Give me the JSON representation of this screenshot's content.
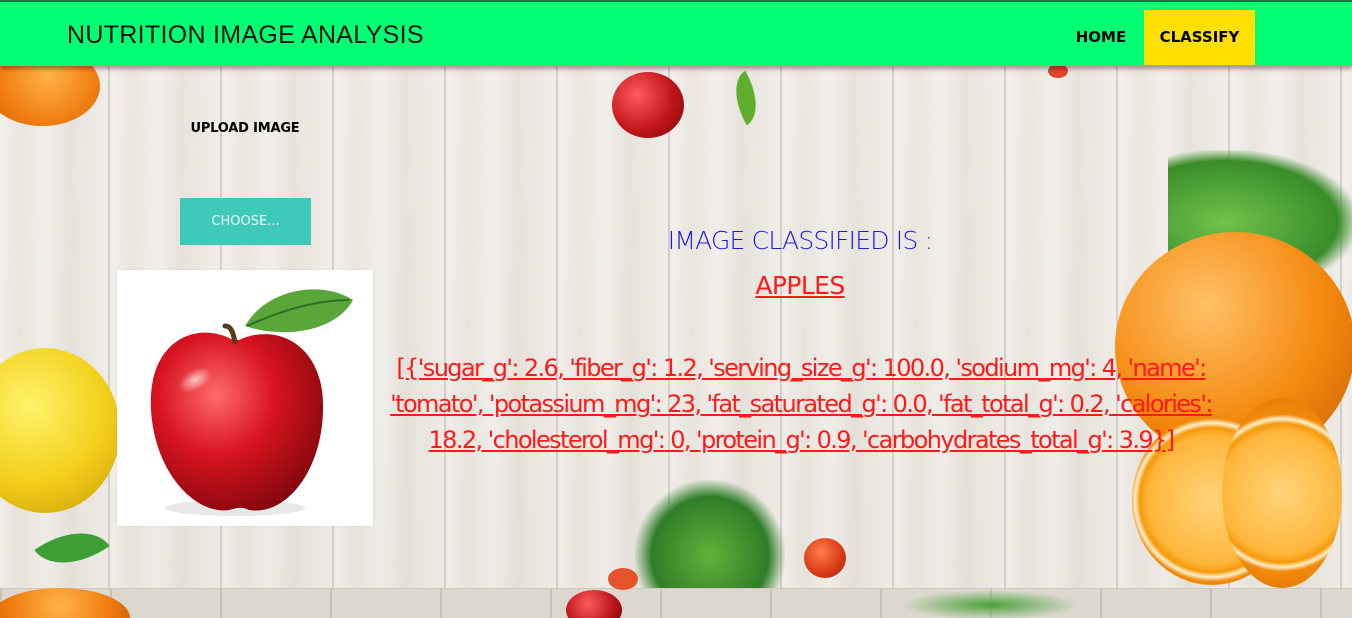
{
  "navbar": {
    "brand": "NUTRITION IMAGE ANALYSIS",
    "home_label": "HOME",
    "classify_label": "CLASSIFY",
    "bar_color": "#00ff72",
    "active_color": "#ffe000"
  },
  "upload": {
    "title": "UPLOAD IMAGE",
    "choose_label": "CHOOSE...",
    "button_color": "#3ec9b9"
  },
  "result": {
    "heading": "IMAGE CLASSIFIED IS :",
    "label": "APPLES",
    "nutrition_text": "[{'sugar_g': 2.6, 'fiber_g': 1.2, 'serving_size_g': 100.0, 'sodium_mg': 4, 'name': 'tomato', 'potassium_mg': 23, 'fat_saturated_g': 0.0, 'fat_total_g': 0.2, 'calories': 18.2, 'cholesterol_mg': 0, 'protein_g': 0.9, 'carbohydrates_total_g': 3.9}]",
    "heading_color": "#1a1ae6",
    "label_color": "#ff1a1a"
  }
}
